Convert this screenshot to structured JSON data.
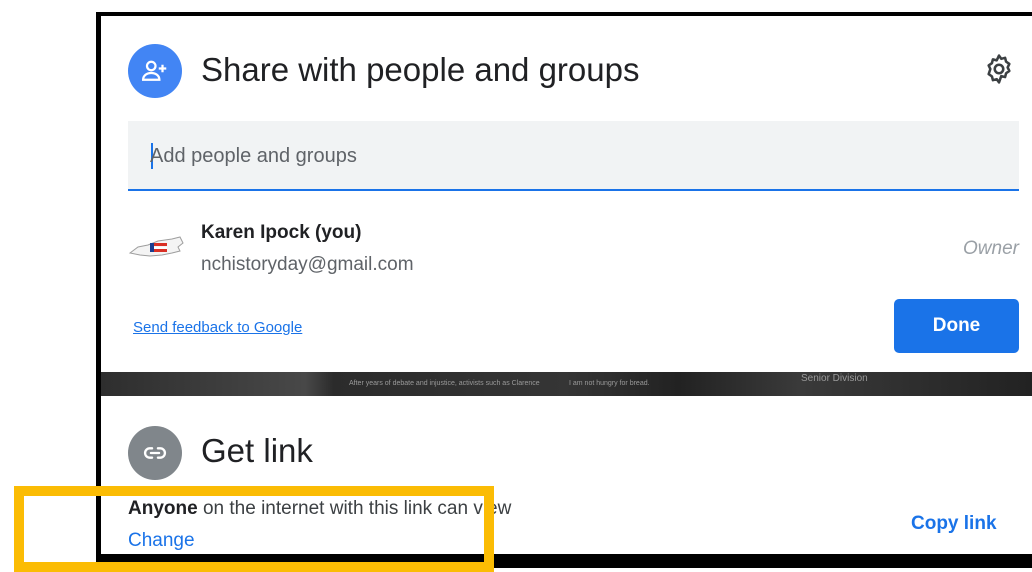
{
  "share_dialog": {
    "title": "Share with people and groups",
    "search": {
      "placeholder": "Add people and groups",
      "value": ""
    },
    "people": [
      {
        "name": "Karen Ipock (you)",
        "email": "nchistoryday@gmail.com",
        "role": "Owner"
      }
    ],
    "feedback_label": "Send feedback to Google",
    "done_label": "Done"
  },
  "background": {
    "blurbs": [
      "After years of debate and injustice, activists such as Clarence",
      "I am not hungry for bread.",
      "Senior Division"
    ]
  },
  "link_dialog": {
    "title": "Get link",
    "access_prefix": "Anyone",
    "access_rest": "on the internet with this link can view",
    "change_label": "Change",
    "copy_label": "Copy link"
  },
  "colors": {
    "accent": "#1a73e8",
    "share_icon_bg": "#4285f4",
    "link_icon_bg": "#80868b",
    "highlight": "#fbbc04"
  },
  "icons": {
    "share": "person-add-icon",
    "settings": "gear-icon",
    "link": "link-icon",
    "avatar": "nc-state-map-avatar"
  }
}
